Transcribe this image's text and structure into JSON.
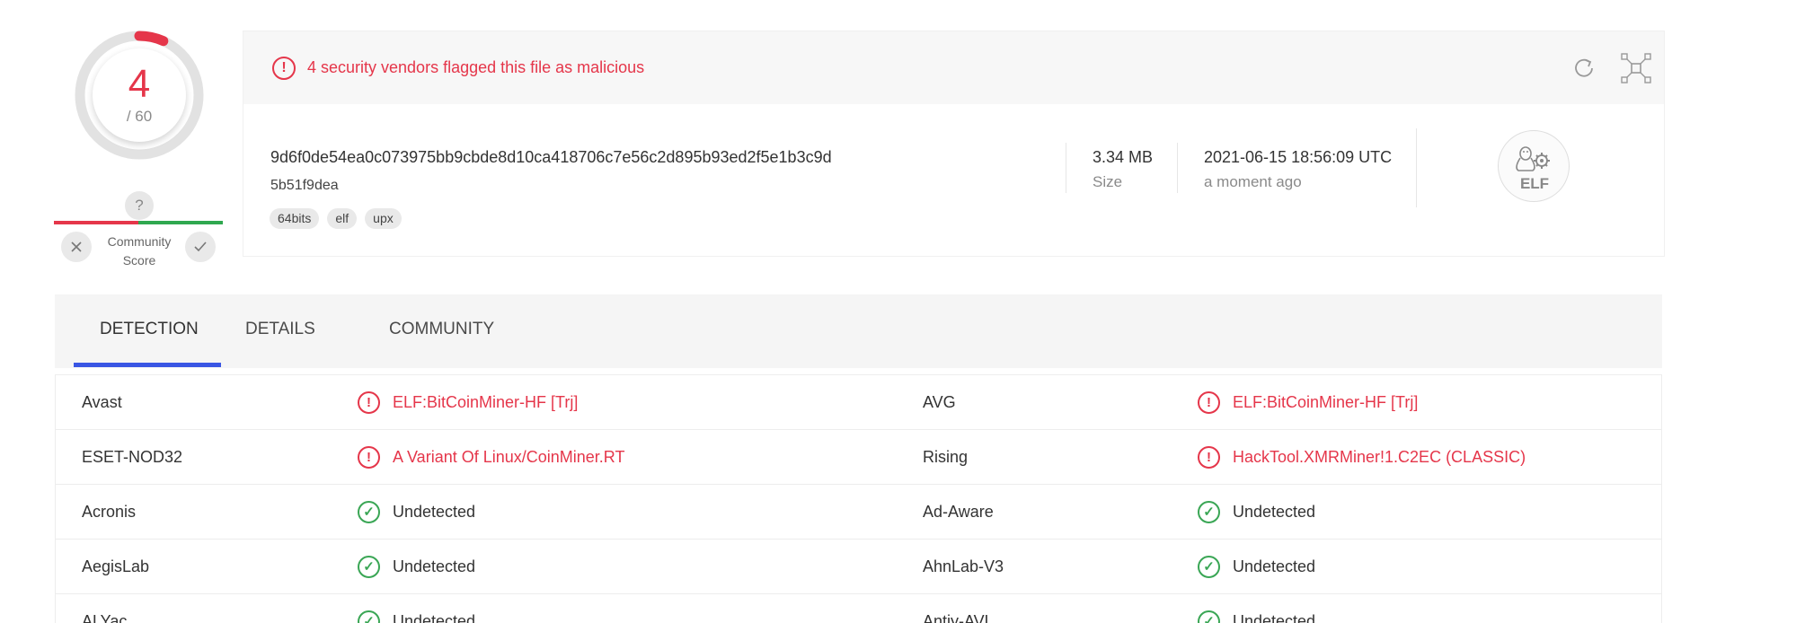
{
  "score": {
    "detections": "4",
    "total": "/ 60",
    "gauge_fraction": 0.0667,
    "colors": {
      "malicious": "#e5364a",
      "clean": "#2fa84f"
    }
  },
  "community": {
    "unknown_glyph": "?",
    "label_line1": "Community",
    "label_line2": "Score"
  },
  "alert": {
    "text": "4 security vendors flagged this file as malicious"
  },
  "file": {
    "hash_line1": "9d6f0de54ea0c073975bb9cbde8d10ca418706c7e56c2d895b93ed2f5e1b3c9d",
    "hash_line2": "5b51f9dea",
    "tags": [
      "64bits",
      "elf",
      "upx"
    ],
    "size_value": "3.34 MB",
    "size_label": "Size",
    "date_value": "2021-06-15 18:56:09 UTC",
    "date_label": "a moment ago",
    "type_icon": "elf-file-type-icon",
    "type_text": "ELF"
  },
  "tabs": [
    {
      "label": "DETECTION",
      "active": true
    },
    {
      "label": "DETAILS",
      "active": false
    },
    {
      "label": "COMMUNITY",
      "active": false
    }
  ],
  "detections": [
    {
      "left": {
        "engine": "Avast",
        "result": "ELF:BitCoinMiner-HF [Trj]",
        "status": "malicious"
      },
      "right": {
        "engine": "AVG",
        "result": "ELF:BitCoinMiner-HF [Trj]",
        "status": "malicious"
      }
    },
    {
      "left": {
        "engine": "ESET-NOD32",
        "result": "A Variant Of Linux/CoinMiner.RT",
        "status": "malicious"
      },
      "right": {
        "engine": "Rising",
        "result": "HackTool.XMRMiner!1.C2EC (CLASSIC)",
        "status": "malicious"
      }
    },
    {
      "left": {
        "engine": "Acronis",
        "result": "Undetected",
        "status": "clean"
      },
      "right": {
        "engine": "Ad-Aware",
        "result": "Undetected",
        "status": "clean"
      }
    },
    {
      "left": {
        "engine": "AegisLab",
        "result": "Undetected",
        "status": "clean"
      },
      "right": {
        "engine": "AhnLab-V3",
        "result": "Undetected",
        "status": "clean"
      }
    },
    {
      "left": {
        "engine": "ALYac",
        "result": "Undetected",
        "status": "clean"
      },
      "right": {
        "engine": "Antiy-AVL",
        "result": "Undetected",
        "status": "clean"
      }
    }
  ]
}
